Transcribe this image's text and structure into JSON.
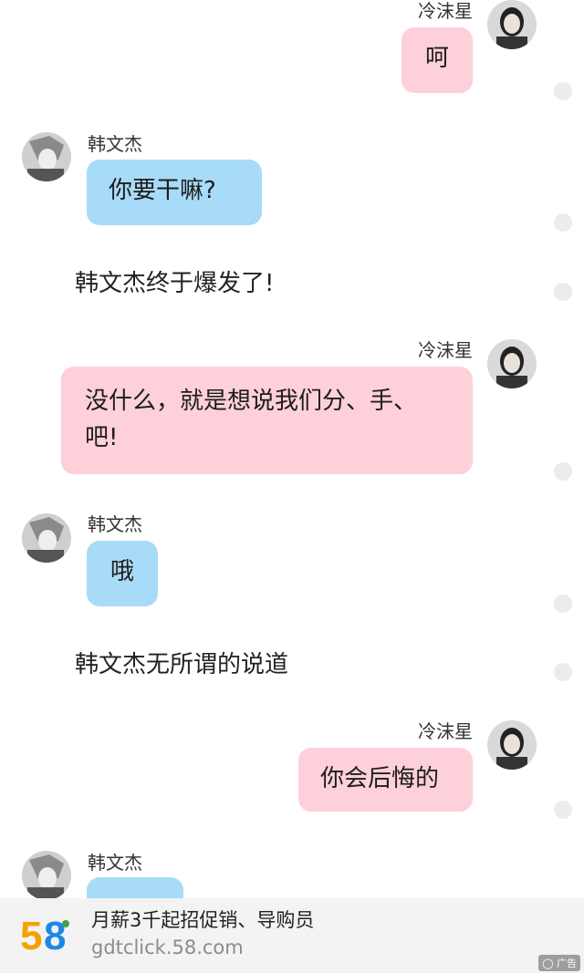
{
  "messages": [
    {
      "sender": "冷沫星",
      "text": "呵"
    },
    {
      "sender": "韩文杰",
      "text": "你要干嘛?"
    },
    {
      "narration": "韩文杰终于爆发了!"
    },
    {
      "sender": "冷沫星",
      "text_line1": "没什么，就是想说我们分、手、",
      "text_line2": "吧!"
    },
    {
      "sender": "韩文杰",
      "text": "哦"
    },
    {
      "narration": "韩文杰无所谓的说道"
    },
    {
      "sender": "冷沫星",
      "text": "你会后悔的"
    },
    {
      "sender": "韩文杰",
      "text": ""
    }
  ],
  "ad": {
    "logo_text": "58",
    "title": "月薪3千起招促销、导购员",
    "domain": "gdtclick.58.com",
    "badge": "广告"
  },
  "colors": {
    "pink_bubble": "#fdd0da",
    "blue_bubble": "#a8dbf7",
    "logo_orange": "#f5a100",
    "logo_blue": "#1e88e5",
    "logo_green": "#43a047"
  }
}
